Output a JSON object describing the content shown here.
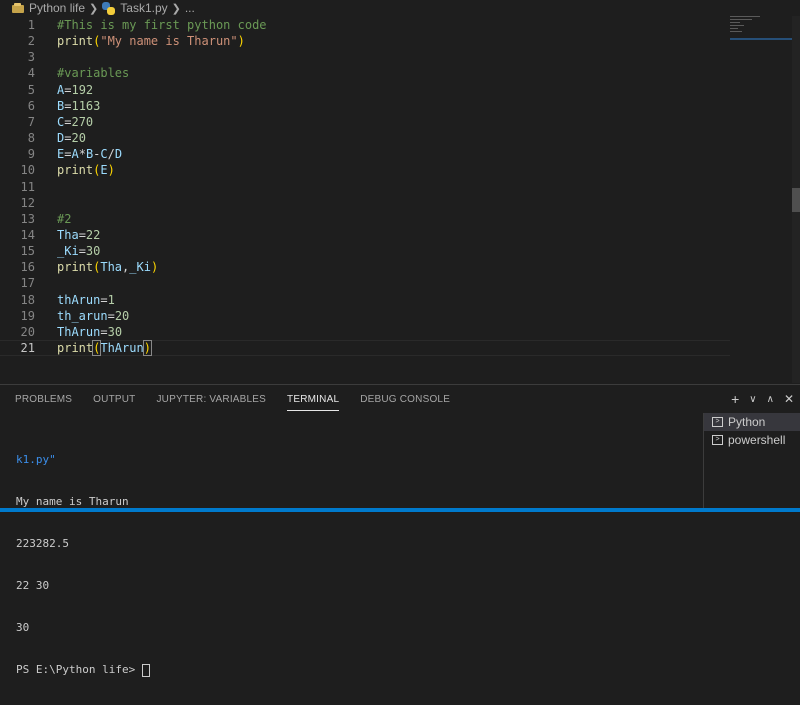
{
  "breadcrumb": {
    "folder": "Python life",
    "file": "Task1.py",
    "more": "..."
  },
  "code_lines": [
    {
      "n": "1",
      "html": "<span class='c-comment'>#This is my first python code</span>"
    },
    {
      "n": "2",
      "html": "<span class='c-fn'>print</span><span class='c-paren'>(</span><span class='c-str'>\"My name is Tharun\"</span><span class='c-paren'>)</span>"
    },
    {
      "n": "3",
      "html": ""
    },
    {
      "n": "4",
      "html": "<span class='c-comment'>#variables</span>"
    },
    {
      "n": "5",
      "html": "<span class='c-var'>A</span><span class='c-op'>=</span><span class='c-num'>192</span>"
    },
    {
      "n": "6",
      "html": "<span class='c-var'>B</span><span class='c-op'>=</span><span class='c-num'>1163</span>"
    },
    {
      "n": "7",
      "html": "<span class='c-var'>C</span><span class='c-op'>=</span><span class='c-num'>270</span>"
    },
    {
      "n": "8",
      "html": "<span class='c-var'>D</span><span class='c-op'>=</span><span class='c-num'>20</span>"
    },
    {
      "n": "9",
      "html": "<span class='c-var'>E</span><span class='c-op'>=</span><span class='c-var'>A</span><span class='c-op'>*</span><span class='c-var'>B</span><span class='c-op'>-</span><span class='c-var'>C</span><span class='c-op'>/</span><span class='c-var'>D</span>"
    },
    {
      "n": "10",
      "html": "<span class='c-fn'>print</span><span class='c-paren'>(</span><span class='c-var'>E</span><span class='c-paren'>)</span>"
    },
    {
      "n": "11",
      "html": ""
    },
    {
      "n": "12",
      "html": ""
    },
    {
      "n": "13",
      "html": "<span class='c-comment'>#2</span>"
    },
    {
      "n": "14",
      "html": "<span class='c-var'>Tha</span><span class='c-op'>=</span><span class='c-num'>22</span>"
    },
    {
      "n": "15",
      "html": "<span class='c-var'>_Ki</span><span class='c-op'>=</span><span class='c-num'>30</span>"
    },
    {
      "n": "16",
      "html": "<span class='c-fn'>print</span><span class='c-paren'>(</span><span class='c-var'>Tha</span><span class='c-op'>,</span><span class='c-var'>_Ki</span><span class='c-paren'>)</span>"
    },
    {
      "n": "17",
      "html": ""
    },
    {
      "n": "18",
      "html": "<span class='c-var'>thArun</span><span class='c-op'>=</span><span class='c-num'>1</span>"
    },
    {
      "n": "19",
      "html": "<span class='c-var'>th_arun</span><span class='c-op'>=</span><span class='c-num'>20</span>"
    },
    {
      "n": "20",
      "html": "<span class='c-var'>ThArun</span><span class='c-op'>=</span><span class='c-num'>30</span>"
    },
    {
      "n": "21",
      "html": "<span class='c-fn'>print</span><span class='c-paren bracket-box'>(</span><span class='c-var'>ThArun</span><span class='c-paren bracket-box'>)</span><span class='cursor'></span>",
      "active": true
    }
  ],
  "panel": {
    "tabs": [
      "PROBLEMS",
      "OUTPUT",
      "JUPYTER: VARIABLES",
      "TERMINAL",
      "DEBUG CONSOLE"
    ],
    "active_tab": "TERMINAL",
    "actions": {
      "add": "+",
      "dropdown": "∨",
      "maximize": "∧",
      "close": "✕"
    }
  },
  "terminal": {
    "lines": [
      "k1.py\"",
      "My name is Tharun",
      "223282.5",
      "22 30",
      "30"
    ],
    "prompt": "PS E:\\Python life> "
  },
  "terminal_list": [
    {
      "label": "Python",
      "selected": true
    },
    {
      "label": "powershell",
      "selected": false
    }
  ],
  "colors": {
    "accent": "#007acc",
    "editor_bg": "#1e1e1e"
  }
}
